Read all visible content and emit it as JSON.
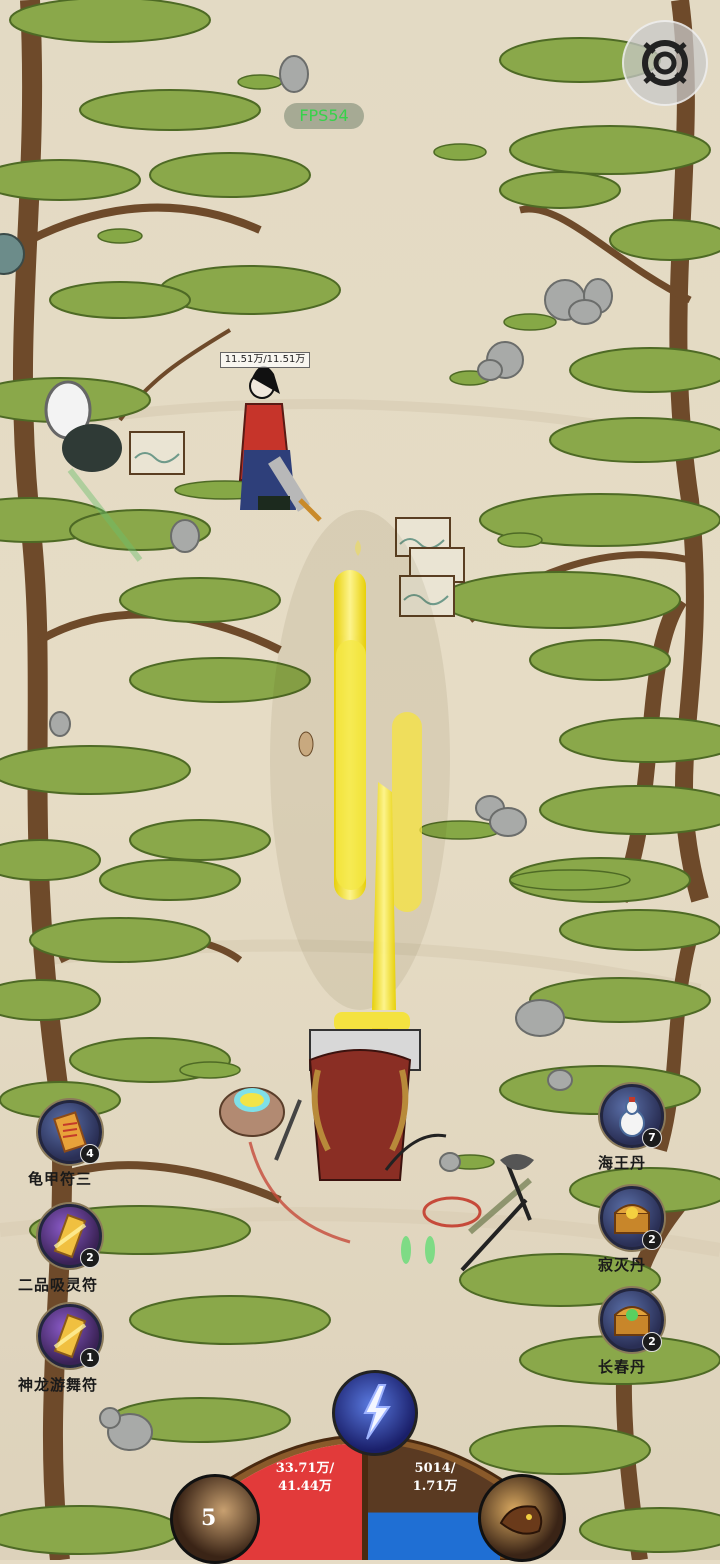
{
  "hud": {
    "fps": "FPS54",
    "hp_label": "33.71万/\n41.44万",
    "hp_fraction": 0.813,
    "mp_label": "5014/\n1.71万",
    "mp_fraction": 0.293,
    "level": "5",
    "colors": {
      "hp": "#e23a3a",
      "mp": "#1f6fd4",
      "frame": "#8a5a2a"
    }
  },
  "enemy": {
    "hp_text": "11.51万/11.51万"
  },
  "left_items": [
    {
      "label": "龟甲符三",
      "count": "4",
      "icon": "scroll-icon"
    },
    {
      "label": "二品吸灵符",
      "count": "2",
      "icon": "talisman-icon"
    },
    {
      "label": "神龙游舞符",
      "count": "1",
      "icon": "talisman-icon"
    }
  ],
  "right_items": [
    {
      "label": "海王丹",
      "count": "7",
      "icon": "gourd-icon"
    },
    {
      "label": "寂灭丹",
      "count": "2",
      "icon": "treasure-chest-icon"
    },
    {
      "label": "长春丹",
      "count": "2",
      "icon": "treasure-chest-icon"
    }
  ],
  "icons": {
    "settings": "settings-icon",
    "skill": "lightning-skill-icon",
    "level_badge": "level-badge-icon",
    "pet": "pet-icon"
  }
}
